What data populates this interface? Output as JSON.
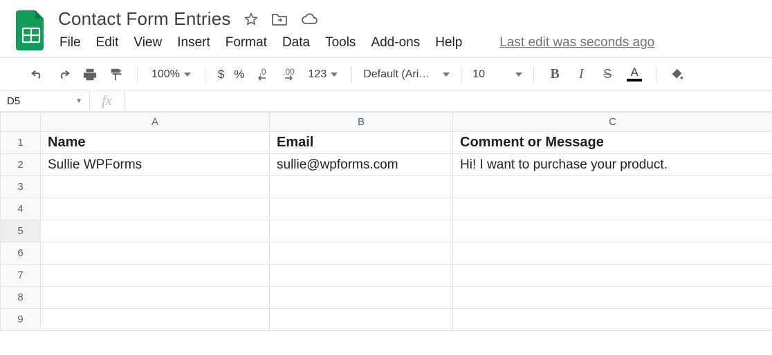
{
  "doc": {
    "title": "Contact Form Entries",
    "last_edit": "Last edit was seconds ago"
  },
  "menu": {
    "file": "File",
    "edit": "Edit",
    "view": "View",
    "insert": "Insert",
    "format": "Format",
    "data": "Data",
    "tools": "Tools",
    "addons": "Add-ons",
    "help": "Help"
  },
  "toolbar": {
    "zoom": "100%",
    "currency": "$",
    "percent": "%",
    "dec_dec": ".0",
    "inc_dec": ".00",
    "more_formats": "123",
    "font": "Default (Ari…",
    "font_size": "10",
    "bold": "B",
    "italic": "I",
    "strike": "S",
    "text_color_letter": "A"
  },
  "formula": {
    "namebox": "D5",
    "value": ""
  },
  "columns": [
    "A",
    "B",
    "C"
  ],
  "row_numbers": [
    "1",
    "2",
    "3",
    "4",
    "5",
    "6",
    "7",
    "8",
    "9"
  ],
  "selected_row": "5",
  "cells": {
    "r1": {
      "A": "Name",
      "B": "Email",
      "C": "Comment or Message"
    },
    "r2": {
      "A": "Sullie WPForms",
      "B": "sullie@wpforms.com",
      "C": "Hi! I want to purchase your product."
    }
  }
}
